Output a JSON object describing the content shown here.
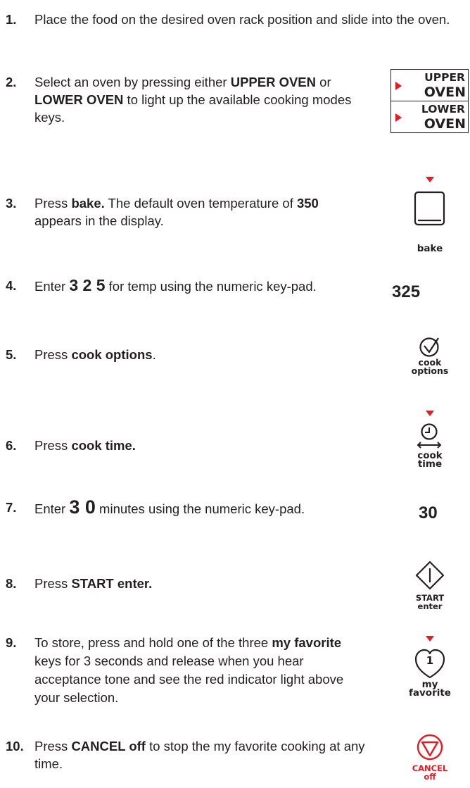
{
  "steps": [
    {
      "num": "1.",
      "parts": [
        "Place the food on the desired oven rack position and slide into the oven."
      ]
    },
    {
      "num": "2.",
      "pre": "Select an oven by pressing either ",
      "b1": "UPPER OVEN",
      "mid": " or ",
      "b2": "LOWER OVEN",
      "post": " to light up the available cooking modes keys."
    },
    {
      "num": "3.",
      "pre": "Press ",
      "b1": "bake.",
      "mid": " The default oven temperature of ",
      "b2": "350",
      "post": " appears in the display."
    },
    {
      "num": "4.",
      "pre": "Enter ",
      "b1": "3 2 5",
      "post": " for temp using the numeric key-pad."
    },
    {
      "num": "5.",
      "pre": "Press ",
      "b1": "cook options",
      "post": "."
    },
    {
      "num": "6.",
      "pre": "Press ",
      "b1": "cook time."
    },
    {
      "num": "7.",
      "pre": "Enter ",
      "b1": "3 0",
      "post": " minutes using the numeric key-pad."
    },
    {
      "num": "8.",
      "pre": "Press ",
      "b1": "START enter."
    },
    {
      "num": "9.",
      "pre": "To store, press and hold one of the three ",
      "b1": "my favorite",
      "post": " keys for 3 seconds and release when you hear acceptance tone and see the red indicator light above your selection."
    },
    {
      "num": "10.",
      "pre": "Press ",
      "b1": "CANCEL off",
      "post": " to stop the my favorite cooking at any time."
    }
  ],
  "keys": {
    "upper_oven": {
      "line1": "UPPER",
      "line2": "OVEN"
    },
    "lower_oven": {
      "line1": "LOWER",
      "line2": "OVEN"
    },
    "bake": "bake",
    "display_temp": "325",
    "cook_options": {
      "line1": "cook",
      "line2": "options"
    },
    "cook_time": {
      "line1": "cook",
      "line2": "time"
    },
    "display_time": "30",
    "start_enter": {
      "line1": "START",
      "line2": "enter"
    },
    "my_favorite": {
      "line1": "my",
      "line2": "favorite",
      "digit": "1"
    },
    "cancel_off": {
      "line1": "CANCEL",
      "line2": "off"
    }
  },
  "colors": {
    "accent": "#e31b23",
    "text": "#231f20"
  }
}
